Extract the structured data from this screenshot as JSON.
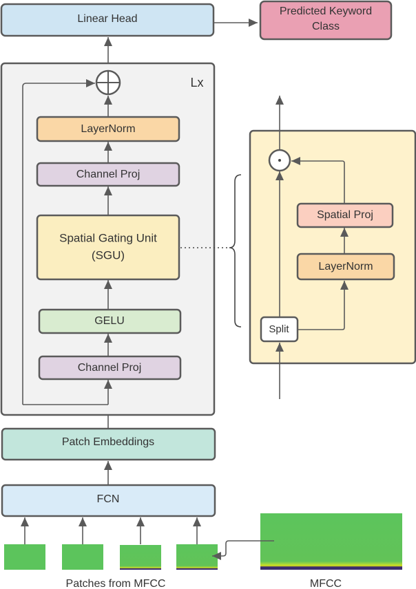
{
  "blocks": {
    "linear_head": "Linear Head",
    "predicted_line1": "Predicted Keyword",
    "predicted_line2": "Class",
    "repeat_label": "Lx",
    "layernorm": "LayerNorm",
    "channel_proj_top": "Channel Proj",
    "sgu_line1": "Spatial Gating Unit",
    "sgu_line2": "(SGU)",
    "gelu": "GELU",
    "channel_proj_bottom": "Channel Proj",
    "patch_embeddings": "Patch Embeddings",
    "fcn": "FCN"
  },
  "sgu_detail": {
    "spatial_proj": "Spatial Proj",
    "layernorm": "LayerNorm",
    "split": "Split"
  },
  "labels": {
    "patches": "Patches from MFCC",
    "mfcc": "MFCC"
  },
  "colors": {
    "linear_head": "#cfe5f3",
    "predicted": "#eaa0b3",
    "lx_panel": "#f2f2f2",
    "layernorm": "#fad7a6",
    "channel_proj": "#e0d3e2",
    "sgu": "#fbeec0",
    "gelu": "#d9ecd0",
    "patch_embeddings": "#c2e6dc",
    "fcn": "#d9ebf8",
    "sgu_panel": "#fef2cc",
    "spatial_proj": "#fbcfc0",
    "mfcc_green": "#5cc45c"
  }
}
